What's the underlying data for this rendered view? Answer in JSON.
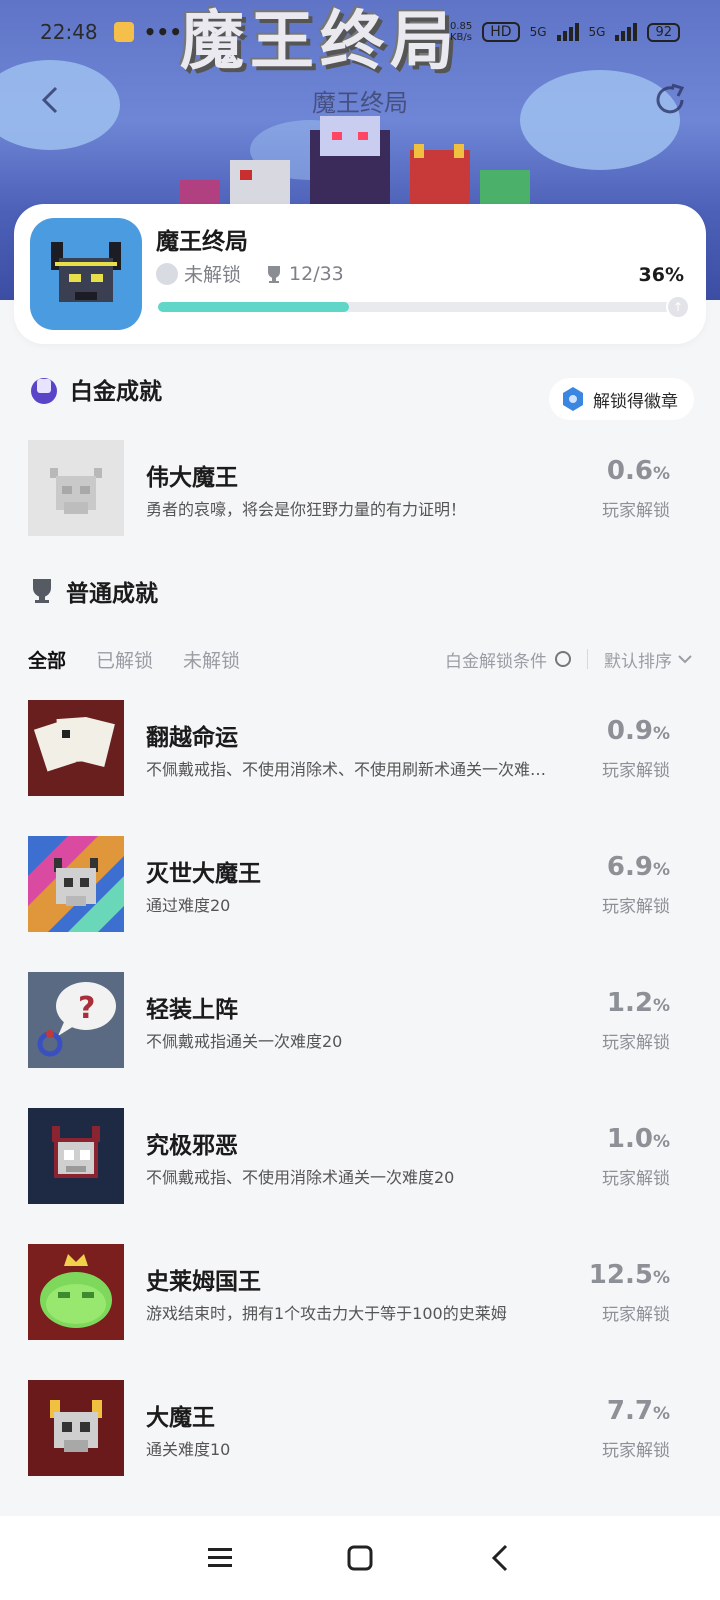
{
  "status": {
    "time": "22:48",
    "network_hd": "HD",
    "net_5g_a": "5G",
    "net_5g_b": "5G",
    "speed_up": "0.85",
    "speed_unit": "KB/s",
    "battery": "92"
  },
  "nav": {
    "title": "魔王终局"
  },
  "game": {
    "name": "魔王终局",
    "lock_label": "未解锁",
    "trophy_count": "12/33",
    "percent_label": "36%",
    "progress": 0.36
  },
  "platinum": {
    "section_title": "白金成就",
    "badge_button": "解锁得徽章",
    "item": {
      "title": "伟大魔王",
      "desc": "勇者的哀嚎，将会是你狂野力量的有力证明！",
      "pct_num": "0.6",
      "pct_unit": "%",
      "sub": "玩家解锁"
    }
  },
  "normal": {
    "section_title": "普通成就",
    "tabs": [
      "全部",
      "已解锁",
      "未解锁"
    ],
    "platinum_condition": "白金解锁条件",
    "sort_label": "默认排序",
    "items": [
      {
        "title": "翻越命运",
        "desc": "不佩戴戒指、不使用消除术、不使用刷新术通关一次难…",
        "pct_num": "0.9",
        "pct_unit": "%",
        "sub": "玩家解锁"
      },
      {
        "title": "灭世大魔王",
        "desc": "通过难度20",
        "pct_num": "6.9",
        "pct_unit": "%",
        "sub": "玩家解锁"
      },
      {
        "title": "轻装上阵",
        "desc": "不佩戴戒指通关一次难度20",
        "pct_num": "1.2",
        "pct_unit": "%",
        "sub": "玩家解锁"
      },
      {
        "title": "究极邪恶",
        "desc": "不佩戴戒指、不使用消除术通关一次难度20",
        "pct_num": "1.0",
        "pct_unit": "%",
        "sub": "玩家解锁"
      },
      {
        "title": "史莱姆国王",
        "desc": "游戏结束时，拥有1个攻击力大于等于100的史莱姆",
        "pct_num": "12.5",
        "pct_unit": "%",
        "sub": "玩家解锁"
      },
      {
        "title": "大魔王",
        "desc": "通关难度10",
        "pct_num": "7.7",
        "pct_unit": "%",
        "sub": "玩家解锁"
      }
    ]
  },
  "colors": {
    "accent": "#5fd6c8",
    "pct_gray": "#8d9096",
    "bg": "#f5f6f8"
  }
}
